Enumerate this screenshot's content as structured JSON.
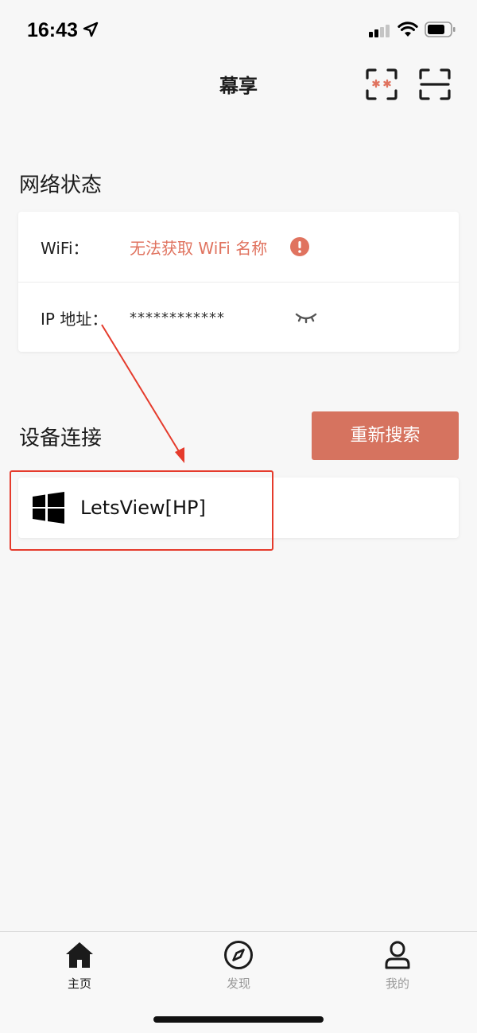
{
  "status_bar": {
    "time": "16:43"
  },
  "header": {
    "title": "幕享"
  },
  "network": {
    "section_title": "网络状态",
    "wifi_label": "WiFi：",
    "wifi_value": "无法获取 WiFi 名称",
    "ip_label": "IP 地址：",
    "ip_value": "************"
  },
  "devices": {
    "section_title": "设备连接",
    "refresh_label": "重新搜索",
    "items": [
      {
        "name": "LetsView[HP]",
        "icon": "windows-icon"
      }
    ]
  },
  "tabs": [
    {
      "label": "主页",
      "icon": "home-icon",
      "active": true
    },
    {
      "label": "发现",
      "icon": "compass-icon",
      "active": false
    },
    {
      "label": "我的",
      "icon": "user-icon",
      "active": false
    }
  ],
  "colors": {
    "accent": "#d6735f",
    "warning_text": "#e0735f",
    "annotation": "#e53b2c",
    "background": "#f7f7f7"
  }
}
